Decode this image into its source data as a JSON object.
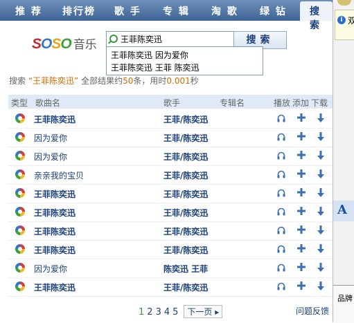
{
  "nav": {
    "items": [
      "推 荐",
      "排行榜",
      "歌 手",
      "专 辑",
      "淘 歌",
      "绿 钻"
    ],
    "selected": "搜 索"
  },
  "logo": {
    "text": "SOSO",
    "music": "音乐"
  },
  "search": {
    "query": "王菲陈奕迅",
    "button": "搜索",
    "suggestions": [
      "王菲陈奕迅 因为爱你",
      "王菲陈奕迅 王菲 陈奕迅"
    ]
  },
  "summary": {
    "prefix": "搜索 ",
    "query_quoted": "“王菲陈奕迅”",
    "mid": " 全部结果约",
    "count": "50",
    "mid2": "条，用时",
    "time": "0.001",
    "suffix": "秒"
  },
  "table": {
    "headers": {
      "type": "类型",
      "song": "歌曲名",
      "singer": "歌手",
      "album": "专辑名",
      "play": "播放",
      "add": "添加",
      "download": "下载"
    },
    "rows": [
      {
        "song": "王菲陈奕迅",
        "bold": true,
        "singer": "王菲/陈奕迅"
      },
      {
        "song": "因为爱你",
        "bold": false,
        "singer": "王菲/陈奕迅"
      },
      {
        "song": "因为爱你",
        "bold": false,
        "singer": "王菲/陈奕迅"
      },
      {
        "song": "亲亲我的宝贝",
        "bold": false,
        "singer": "王菲/陈奕迅"
      },
      {
        "song": "王菲陈奕迅",
        "bold": true,
        "singer": "王菲/陈奕迅"
      },
      {
        "song": "王菲陈奕迅",
        "bold": true,
        "singer": "王菲/陈奕迅"
      },
      {
        "song": "王菲陈奕迅",
        "bold": true,
        "singer": "王菲/陈奕迅"
      },
      {
        "song": "王菲陈奕迅",
        "bold": true,
        "singer": "王菲/陈奕迅"
      },
      {
        "song": "因为爱你",
        "bold": false,
        "singer": "陈奕迅 王菲"
      },
      {
        "song": "王菲陈奕迅",
        "bold": true,
        "singer": "王菲/陈奕迅"
      }
    ],
    "icons": {
      "type": "soso-music-icon",
      "play": "headphones-icon",
      "add": "plus-icon",
      "download": "download-arrow-icon"
    }
  },
  "pager": {
    "pages": [
      "1",
      "2",
      "3",
      "4",
      "5"
    ],
    "current": "1",
    "next": "下一页",
    "feedback": "问题反馈"
  },
  "side": {
    "tip_text": "双",
    "font_icon": "A",
    "bottom_text": "品牌"
  },
  "colors": {
    "nav": "#3d6496",
    "link": "#1a3f7a",
    "highlight": "#d06a00",
    "header_bg": "#dfeaf6"
  }
}
